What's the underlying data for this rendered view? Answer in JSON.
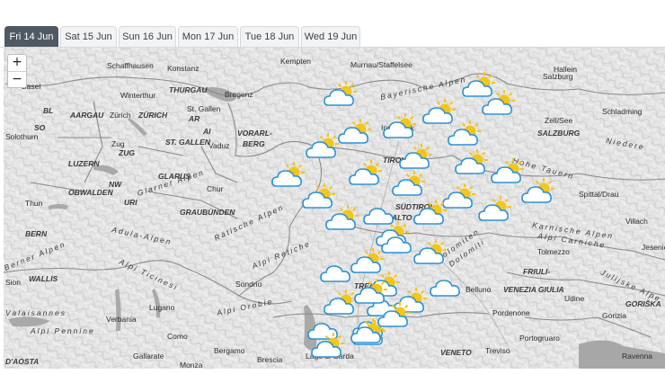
{
  "tabs": [
    {
      "label": "Fri 14 Jun",
      "active": true
    },
    {
      "label": "Sat 15 Jun",
      "active": false
    },
    {
      "label": "Sun 16 Jun",
      "active": false
    },
    {
      "label": "Mon 17 Jun",
      "active": false
    },
    {
      "label": "Tue 18 Jun",
      "active": false
    },
    {
      "label": "Wed 19 Jun",
      "active": false
    }
  ],
  "zoom": {
    "in": "+",
    "out": "−"
  },
  "places": [
    "Kempten",
    "Murnau/Staffelsee",
    "Salzburg",
    "Hallein",
    "Schaffhausen",
    "Konstanz",
    "Basel",
    "Winterthur",
    "THURGAU",
    "Bregenz",
    "BL",
    "AARGAU",
    "Zürich",
    "ZÜRICH",
    "St. Gallen",
    "AR",
    "AI",
    "Solothurn",
    "SO",
    "Zug",
    "ZUG",
    "ST. GALLEN",
    "Vaduz",
    "VORARL-",
    "BERG",
    "LUZERN",
    "GLARUS",
    "OBWALDEN",
    "NW",
    "Chur",
    "Thun",
    "URI",
    "GRAUBÜNDEN",
    "BERN",
    "Adula-Alpen",
    "Sion",
    "WALLIS",
    "Valaisannes",
    "Sondrio",
    "Lugano",
    "Verbania",
    "Alpi Pennine",
    "Como",
    "Bergamo",
    "Gallarate",
    "D'AOSTA",
    "Monza",
    "Brescia",
    "VENETO",
    "Treviso",
    "Pordenone",
    "Portogruaro",
    "Belluno",
    "Udine",
    "Gorizia",
    "Tolmezzo",
    "FRIULI-",
    "VENEZIA GIULIA",
    "Villach",
    "Spittal/Drau",
    "Zell/See",
    "SALZBURG",
    "Schladming",
    "TIROL",
    "SÜDTIROL",
    "ALTO ADIGE",
    "TRENTINO",
    "GORIŠKA",
    "Jesenic",
    "Julijske Alpe",
    "Karnische Alpen",
    "Alpi Carniche",
    "Bayerische Alpen",
    "Hohe Tauern",
    "Niedere",
    "Rätische Alpen",
    "Alpi Retiche",
    "Alpi Orobie",
    "Alpi Ticinesi",
    "Berner Alpen",
    "Glarner Alpen",
    "Dolomiten",
    "Dolomiti",
    "Innsbruck",
    "Lago di Garda",
    "Ravenna"
  ],
  "weather_icons": [
    {
      "condition": "partly-cloudy"
    },
    {
      "condition": "partly-cloudy"
    },
    {
      "condition": "partly-cloudy"
    },
    {
      "condition": "partly-cloudy"
    },
    {
      "condition": "partly-cloudy"
    },
    {
      "condition": "partly-cloudy"
    },
    {
      "condition": "partly-cloudy"
    },
    {
      "condition": "partly-cloudy"
    },
    {
      "condition": "partly-cloudy"
    },
    {
      "condition": "partly-cloudy"
    },
    {
      "condition": "partly-cloudy"
    },
    {
      "condition": "partly-cloudy"
    },
    {
      "condition": "partly-cloudy"
    },
    {
      "condition": "partly-cloudy"
    },
    {
      "condition": "partly-cloudy"
    },
    {
      "condition": "partly-cloudy"
    },
    {
      "condition": "partly-cloudy"
    },
    {
      "condition": "partly-cloudy"
    },
    {
      "condition": "partly-cloudy"
    },
    {
      "condition": "partly-cloudy"
    },
    {
      "condition": "cloudy"
    },
    {
      "condition": "partly-cloudy"
    },
    {
      "condition": "cloudy"
    },
    {
      "condition": "partly-cloudy"
    },
    {
      "condition": "partly-cloudy"
    },
    {
      "condition": "cloudy"
    },
    {
      "condition": "partly-cloudy"
    },
    {
      "condition": "cloudy"
    },
    {
      "condition": "partly-cloudy"
    },
    {
      "condition": "partly-cloudy"
    },
    {
      "condition": "cloudy"
    },
    {
      "condition": "cloudy"
    },
    {
      "condition": "partly-cloudy"
    },
    {
      "condition": "cloudy"
    },
    {
      "condition": "partly-cloudy"
    },
    {
      "condition": "partly-cloudy"
    },
    {
      "condition": "partly-cloudy"
    },
    {
      "condition": "partly-cloudy"
    }
  ],
  "colors": {
    "tab_active": "#4f5963",
    "cloud": "#ffffff",
    "cloud_outline": "#2a93d5",
    "sun": "#f5c518",
    "lake": "#a8a8a8"
  }
}
